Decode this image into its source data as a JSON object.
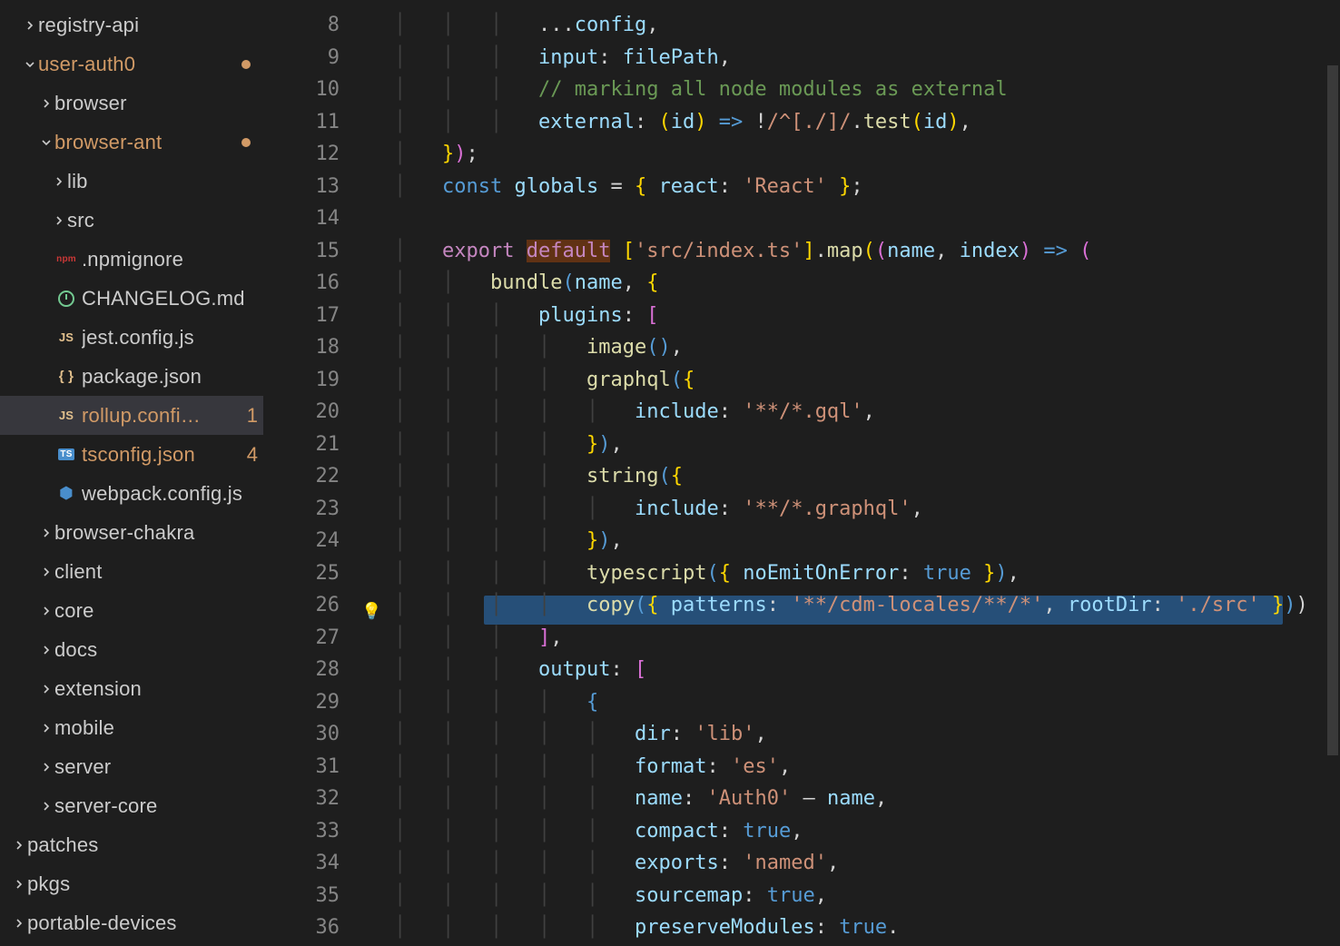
{
  "sidebar": {
    "items": [
      {
        "label": "registry-api",
        "depth": 1,
        "chev": "right"
      },
      {
        "label": "user-auth0",
        "depth": 1,
        "chev": "down",
        "modified": true,
        "dot": true
      },
      {
        "label": "browser",
        "depth": 2,
        "chev": "right"
      },
      {
        "label": "browser-ant",
        "depth": 2,
        "chev": "down",
        "modified": true,
        "dot": true
      },
      {
        "label": "lib",
        "depth": 3,
        "chev": "right"
      },
      {
        "label": "src",
        "depth": 3,
        "chev": "right"
      },
      {
        "label": ".npmignore",
        "depth": 3,
        "icon": "npm"
      },
      {
        "label": "CHANGELOG.md",
        "depth": 3,
        "icon": "clock"
      },
      {
        "label": "jest.config.js",
        "depth": 3,
        "icon": "js"
      },
      {
        "label": "package.json",
        "depth": 3,
        "icon": "json"
      },
      {
        "label": "rollup.confi…",
        "depth": 3,
        "icon": "js",
        "modified": true,
        "badge": "1",
        "active": true
      },
      {
        "label": "tsconfig.json",
        "depth": 3,
        "icon": "ts",
        "warning": true,
        "badge": "4"
      },
      {
        "label": "webpack.config.js",
        "depth": 3,
        "icon": "cube"
      },
      {
        "label": "browser-chakra",
        "depth": 2,
        "chev": "right"
      },
      {
        "label": "client",
        "depth": 2,
        "chev": "right"
      },
      {
        "label": "core",
        "depth": 2,
        "chev": "right"
      },
      {
        "label": "docs",
        "depth": 2,
        "chev": "right"
      },
      {
        "label": "extension",
        "depth": 2,
        "chev": "right"
      },
      {
        "label": "mobile",
        "depth": 2,
        "chev": "right"
      },
      {
        "label": "server",
        "depth": 2,
        "chev": "right"
      },
      {
        "label": "server-core",
        "depth": 2,
        "chev": "right"
      },
      {
        "label": "patches",
        "depth": 0,
        "chev": "right"
      },
      {
        "label": "pkgs",
        "depth": 0,
        "chev": "right"
      },
      {
        "label": "portable-devices",
        "depth": 0,
        "chev": "right"
      }
    ]
  },
  "editor": {
    "first_line_no": 8,
    "lightbulb_line": 26,
    "highlighted_word": "default",
    "lines": [
      {
        "n": 8,
        "ind": 3,
        "tokens": [
          [
            "pn",
            "..."
          ],
          [
            "id",
            "config"
          ],
          [
            "pn",
            ","
          ]
        ]
      },
      {
        "n": 9,
        "ind": 3,
        "tokens": [
          [
            "id",
            "input"
          ],
          [
            "pn",
            ": "
          ],
          [
            "id",
            "filePath"
          ],
          [
            "pn",
            ","
          ]
        ]
      },
      {
        "n": 10,
        "ind": 3,
        "tokens": [
          [
            "cm",
            "// marking all node modules as external"
          ]
        ]
      },
      {
        "n": 11,
        "ind": 3,
        "tokens": [
          [
            "id",
            "external"
          ],
          [
            "pn",
            ": "
          ],
          [
            "ye",
            "("
          ],
          [
            "id",
            "id"
          ],
          [
            "ye",
            ")"
          ],
          [
            "pn",
            " "
          ],
          [
            "bl",
            "=>"
          ],
          [
            "pn",
            " !"
          ],
          [
            "st",
            "/^[./]/"
          ],
          [
            "pn",
            "."
          ],
          [
            "fn",
            "test"
          ],
          [
            "ye",
            "("
          ],
          [
            "id",
            "id"
          ],
          [
            "ye",
            ")"
          ],
          [
            "pn",
            ","
          ]
        ]
      },
      {
        "n": 12,
        "ind": 1,
        "tokens": [
          [
            "ye",
            "}"
          ],
          [
            "pk",
            ")"
          ],
          [
            "pn",
            ";"
          ]
        ]
      },
      {
        "n": 13,
        "ind": 1,
        "tokens": [
          [
            "bl",
            "const"
          ],
          [
            "pn",
            " "
          ],
          [
            "id",
            "globals"
          ],
          [
            "pn",
            " = "
          ],
          [
            "ye",
            "{"
          ],
          [
            "pn",
            " "
          ],
          [
            "id",
            "react"
          ],
          [
            "pn",
            ": "
          ],
          [
            "st",
            "'React'"
          ],
          [
            "pn",
            " "
          ],
          [
            "ye",
            "}"
          ],
          [
            "pn",
            ";"
          ]
        ]
      },
      {
        "n": 14,
        "ind": 0,
        "tokens": []
      },
      {
        "n": 15,
        "ind": 1,
        "tokens": [
          [
            "kw",
            "export"
          ],
          [
            "pn",
            " "
          ],
          [
            "kw hl",
            "default"
          ],
          [
            "pn",
            " "
          ],
          [
            "ye",
            "["
          ],
          [
            "st",
            "'src/index.ts'"
          ],
          [
            "ye",
            "]"
          ],
          [
            "pn",
            "."
          ],
          [
            "fn",
            "map"
          ],
          [
            "ye",
            "("
          ],
          [
            "pk",
            "("
          ],
          [
            "id",
            "name"
          ],
          [
            "pn",
            ", "
          ],
          [
            "id",
            "index"
          ],
          [
            "pk",
            ")"
          ],
          [
            "pn",
            " "
          ],
          [
            "bl",
            "=>"
          ],
          [
            "pn",
            " "
          ],
          [
            "pk",
            "("
          ]
        ]
      },
      {
        "n": 16,
        "ind": 2,
        "tokens": [
          [
            "fn",
            "bundle"
          ],
          [
            "bl",
            "("
          ],
          [
            "id",
            "name"
          ],
          [
            "pn",
            ", "
          ],
          [
            "ye",
            "{"
          ]
        ]
      },
      {
        "n": 17,
        "ind": 3,
        "tokens": [
          [
            "id",
            "plugins"
          ],
          [
            "pn",
            ": "
          ],
          [
            "pk",
            "["
          ]
        ]
      },
      {
        "n": 18,
        "ind": 4,
        "tokens": [
          [
            "fn",
            "image"
          ],
          [
            "bl",
            "("
          ],
          [
            "bl",
            ")"
          ],
          [
            "pn",
            ","
          ]
        ]
      },
      {
        "n": 19,
        "ind": 4,
        "tokens": [
          [
            "fn",
            "graphql"
          ],
          [
            "bl",
            "("
          ],
          [
            "ye",
            "{"
          ]
        ]
      },
      {
        "n": 20,
        "ind": 5,
        "tokens": [
          [
            "id",
            "include"
          ],
          [
            "pn",
            ": "
          ],
          [
            "st",
            "'**/*.gql'"
          ],
          [
            "pn",
            ","
          ]
        ]
      },
      {
        "n": 21,
        "ind": 4,
        "tokens": [
          [
            "ye",
            "}"
          ],
          [
            "bl",
            ")"
          ],
          [
            "pn",
            ","
          ]
        ]
      },
      {
        "n": 22,
        "ind": 4,
        "tokens": [
          [
            "fn",
            "string"
          ],
          [
            "bl",
            "("
          ],
          [
            "ye",
            "{"
          ]
        ]
      },
      {
        "n": 23,
        "ind": 5,
        "tokens": [
          [
            "id",
            "include"
          ],
          [
            "pn",
            ": "
          ],
          [
            "st",
            "'**/*.graphql'"
          ],
          [
            "pn",
            ","
          ]
        ]
      },
      {
        "n": 24,
        "ind": 4,
        "tokens": [
          [
            "ye",
            "}"
          ],
          [
            "bl",
            ")"
          ],
          [
            "pn",
            ","
          ]
        ]
      },
      {
        "n": 25,
        "ind": 4,
        "tokens": [
          [
            "fn",
            "typescript"
          ],
          [
            "bl",
            "("
          ],
          [
            "ye",
            "{"
          ],
          [
            "pn",
            " "
          ],
          [
            "id",
            "noEmitOnError"
          ],
          [
            "pn",
            ": "
          ],
          [
            "kw2",
            "true"
          ],
          [
            "pn",
            " "
          ],
          [
            "ye",
            "}"
          ],
          [
            "bl",
            ")"
          ],
          [
            "pn",
            ","
          ]
        ]
      },
      {
        "n": 26,
        "ind": 4,
        "tokens": [
          [
            "fn",
            "copy"
          ],
          [
            "bl",
            "("
          ],
          [
            "ye",
            "{"
          ],
          [
            "pn",
            " "
          ],
          [
            "id",
            "patterns"
          ],
          [
            "pn",
            ": "
          ],
          [
            "st",
            "'**/cdm-locales/**/*'"
          ],
          [
            "pn",
            ", "
          ],
          [
            "id",
            "rootDir"
          ],
          [
            "pn",
            ": "
          ],
          [
            "st",
            "'./src'"
          ],
          [
            "pn",
            " "
          ],
          [
            "ye",
            "}"
          ],
          [
            "bl",
            ")"
          ],
          [
            "pn",
            ")"
          ]
        ]
      },
      {
        "n": 27,
        "ind": 3,
        "tokens": [
          [
            "pk",
            "]"
          ],
          [
            "pn",
            ","
          ]
        ]
      },
      {
        "n": 28,
        "ind": 3,
        "tokens": [
          [
            "id",
            "output"
          ],
          [
            "pn",
            ": "
          ],
          [
            "pk",
            "["
          ]
        ]
      },
      {
        "n": 29,
        "ind": 4,
        "tokens": [
          [
            "bl",
            "{"
          ]
        ]
      },
      {
        "n": 30,
        "ind": 5,
        "tokens": [
          [
            "id",
            "dir"
          ],
          [
            "pn",
            ": "
          ],
          [
            "st",
            "'lib'"
          ],
          [
            "pn",
            ","
          ]
        ]
      },
      {
        "n": 31,
        "ind": 5,
        "tokens": [
          [
            "id",
            "format"
          ],
          [
            "pn",
            ": "
          ],
          [
            "st",
            "'es'"
          ],
          [
            "pn",
            ","
          ]
        ]
      },
      {
        "n": 32,
        "ind": 5,
        "tokens": [
          [
            "id",
            "name"
          ],
          [
            "pn",
            ": "
          ],
          [
            "st",
            "'Auth0'"
          ],
          [
            "pn",
            " – "
          ],
          [
            "id",
            "name"
          ],
          [
            "pn",
            ","
          ]
        ]
      },
      {
        "n": 33,
        "ind": 5,
        "tokens": [
          [
            "id",
            "compact"
          ],
          [
            "pn",
            ": "
          ],
          [
            "kw2",
            "true"
          ],
          [
            "pn",
            ","
          ]
        ]
      },
      {
        "n": 34,
        "ind": 5,
        "tokens": [
          [
            "id",
            "exports"
          ],
          [
            "pn",
            ": "
          ],
          [
            "st",
            "'named'"
          ],
          [
            "pn",
            ","
          ]
        ]
      },
      {
        "n": 35,
        "ind": 5,
        "tokens": [
          [
            "id",
            "sourcemap"
          ],
          [
            "pn",
            ": "
          ],
          [
            "kw2",
            "true"
          ],
          [
            "pn",
            ","
          ]
        ]
      },
      {
        "n": 36,
        "ind": 5,
        "tokens": [
          [
            "id",
            "preserveModules"
          ],
          [
            "pn",
            ": "
          ],
          [
            "kw2",
            "true"
          ],
          [
            "pn",
            "."
          ]
        ]
      }
    ]
  }
}
